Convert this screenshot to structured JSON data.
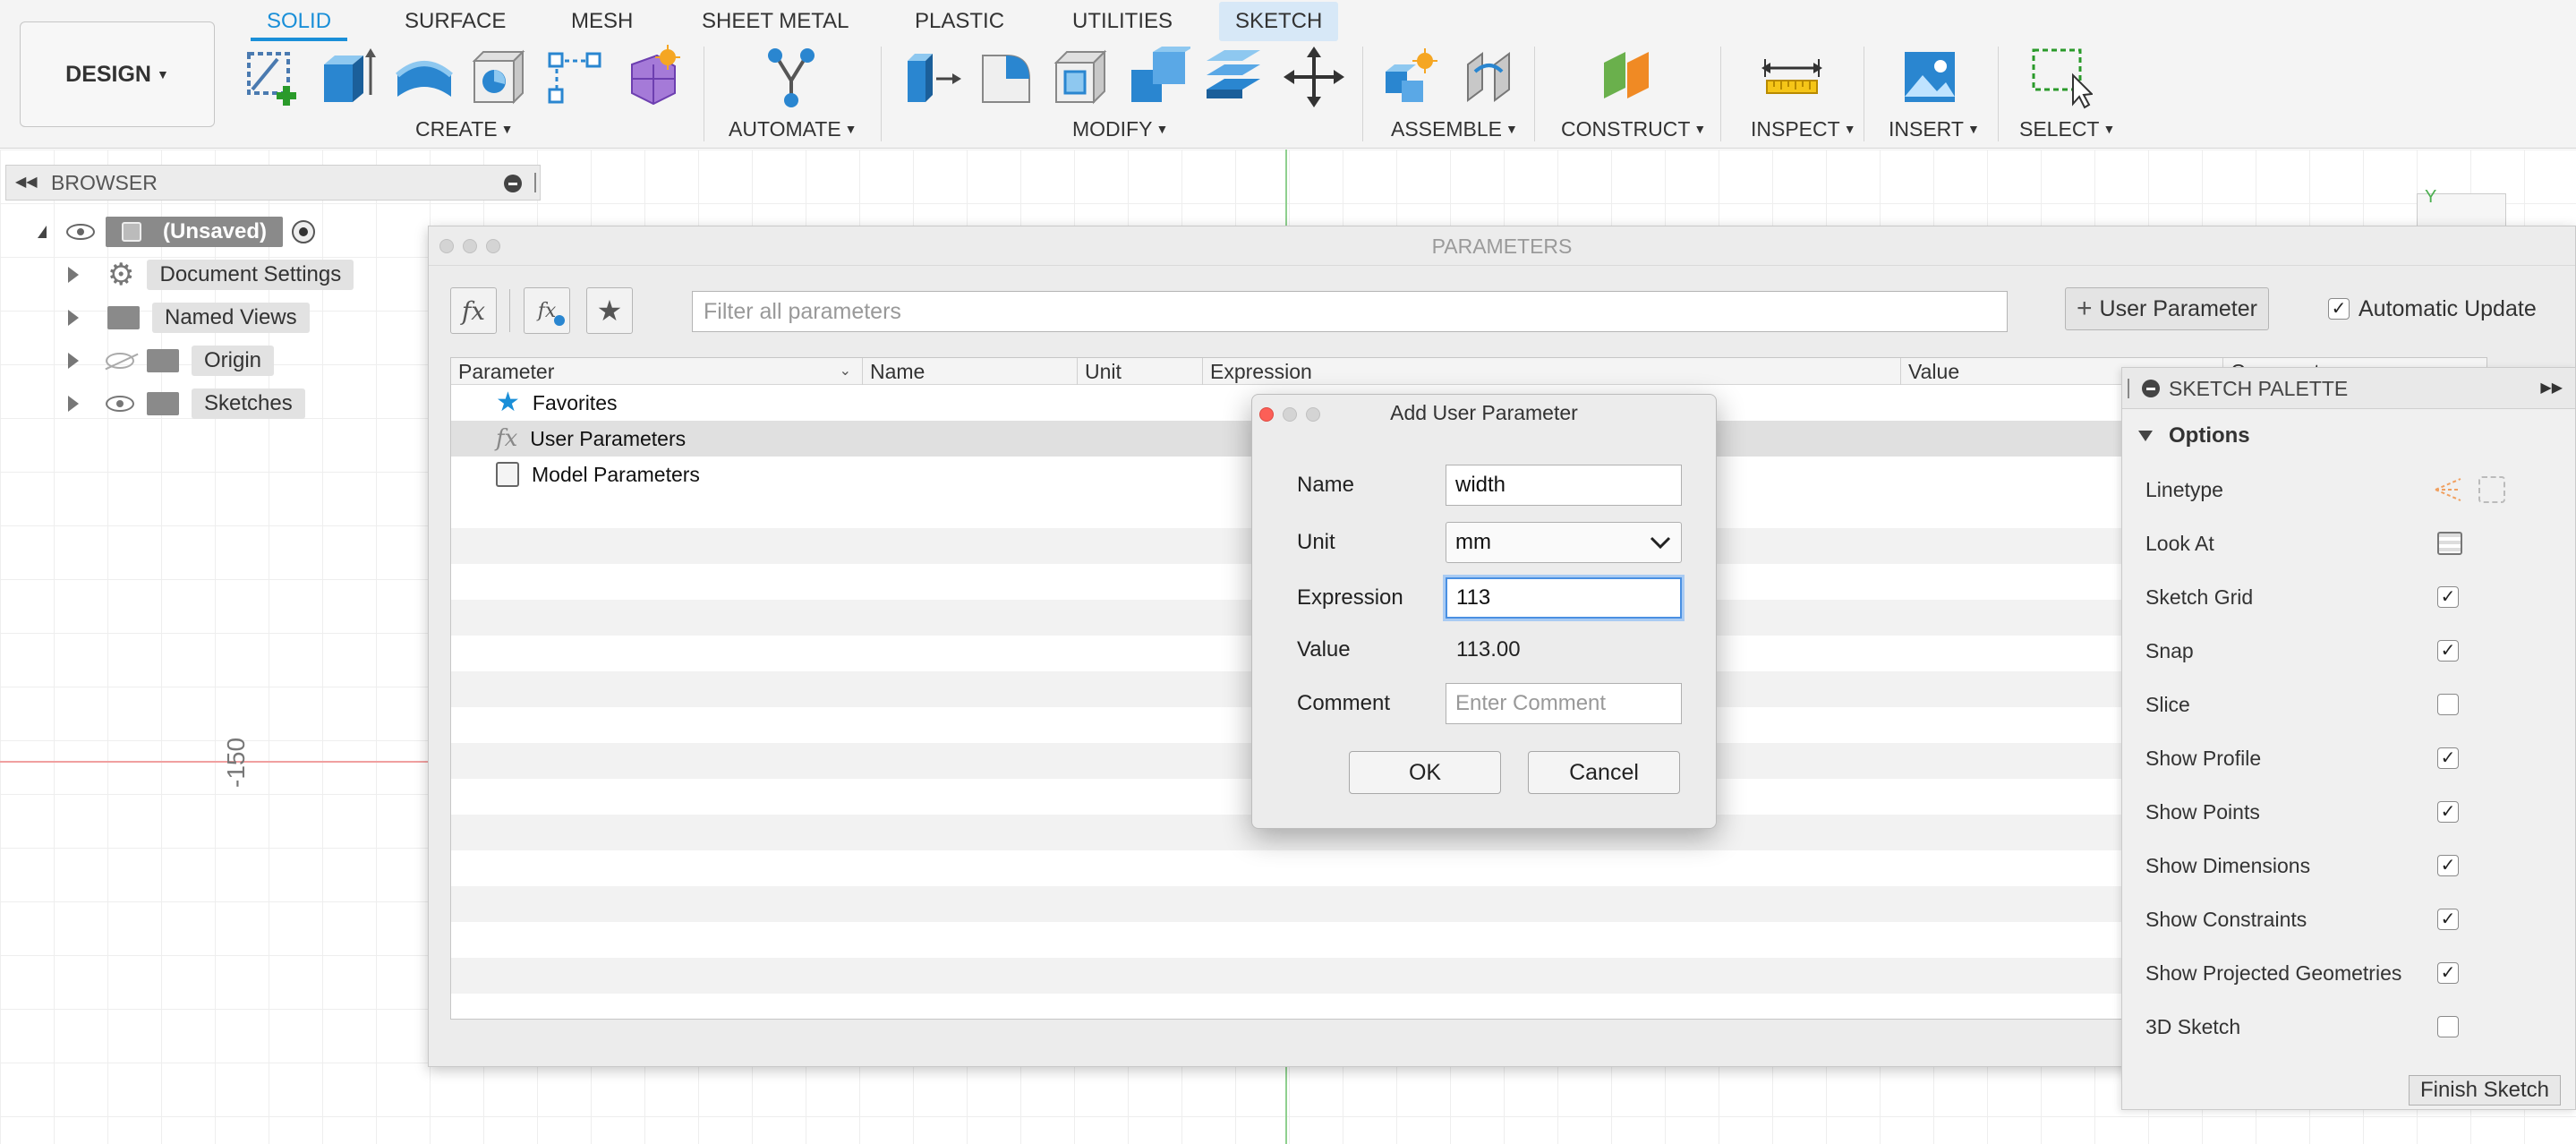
{
  "toolbar": {
    "design_label": "DESIGN",
    "tabs": [
      "SOLID",
      "SURFACE",
      "MESH",
      "SHEET METAL",
      "PLASTIC",
      "UTILITIES",
      "SKETCH"
    ],
    "groups": {
      "create": "CREATE",
      "automate": "AUTOMATE",
      "modify": "MODIFY",
      "assemble": "ASSEMBLE",
      "construct": "CONSTRUCT",
      "inspect": "INSPECT",
      "insert": "INSERT",
      "select": "SELECT"
    },
    "accent_color": "#1a8fd8"
  },
  "canvas": {
    "axis_label": "-150"
  },
  "browser": {
    "title": "BROWSER",
    "root": "(Unsaved)",
    "items": [
      "Document Settings",
      "Named Views",
      "Origin",
      "Sketches"
    ]
  },
  "parameters": {
    "title": "PARAMETERS",
    "filter_placeholder": "Filter all parameters",
    "user_param_button": "User Parameter",
    "auto_update_label": "Automatic Update",
    "columns": [
      "Parameter",
      "Name",
      "Unit",
      "Expression",
      "Value",
      "Comment"
    ],
    "rows": [
      "Favorites",
      "User Parameters",
      "Model Parameters"
    ]
  },
  "add_dialog": {
    "title": "Add User Parameter",
    "name_label": "Name",
    "name_value": "width",
    "unit_label": "Unit",
    "unit_value": "mm",
    "expression_label": "Expression",
    "expression_value": "113",
    "value_label": "Value",
    "value_value": "113.00",
    "comment_label": "Comment",
    "comment_placeholder": "Enter Comment",
    "ok_label": "OK",
    "cancel_label": "Cancel"
  },
  "palette": {
    "title": "SKETCH PALETTE",
    "section": "Options",
    "items": [
      {
        "label": "Linetype"
      },
      {
        "label": "Look At"
      },
      {
        "label": "Sketch Grid",
        "checked": true
      },
      {
        "label": "Snap",
        "checked": true
      },
      {
        "label": "Slice",
        "checked": false
      },
      {
        "label": "Show Profile",
        "checked": true
      },
      {
        "label": "Show Points",
        "checked": true
      },
      {
        "label": "Show Dimensions",
        "checked": true
      },
      {
        "label": "Show Constraints",
        "checked": true
      },
      {
        "label": "Show Projected Geometries",
        "checked": true
      },
      {
        "label": "3D Sketch",
        "checked": false
      }
    ],
    "finish_label": "Finish Sketch"
  }
}
